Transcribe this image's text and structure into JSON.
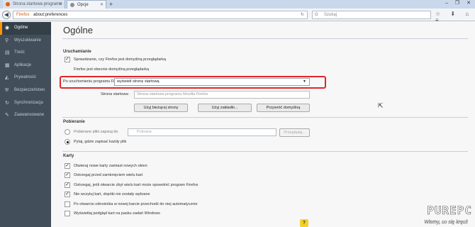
{
  "browser": {
    "tabs": [
      {
        "label": "Strona startowa programu M...",
        "active": false
      },
      {
        "label": "Opcje",
        "active": true
      }
    ],
    "new_tab": "+",
    "window_controls": "–  ❐  ✕",
    "url_brand": "Firefox",
    "url": "about:preferences",
    "search_placeholder": "Szukaj",
    "toolbar_icons": "☆ ⬇ ⌂ ≡"
  },
  "sidebar": {
    "items": [
      {
        "label": "Ogólne",
        "icon": "◉"
      },
      {
        "label": "Wyszukiwanie",
        "icon": "⚲"
      },
      {
        "label": "Treść",
        "icon": "▤"
      },
      {
        "label": "Aplikacje",
        "icon": "▦"
      },
      {
        "label": "Prywatność",
        "icon": "◭"
      },
      {
        "label": "Bezpieczeństwo",
        "icon": "⛨"
      },
      {
        "label": "Synchronizacja",
        "icon": "↻"
      },
      {
        "label": "Zaawansowane",
        "icon": "✎"
      }
    ]
  },
  "page": {
    "title": "Ogólne",
    "startup": {
      "heading": "Uruchamianie",
      "default_check_label": "Sprawdzanie, czy Firefox jest domyślną przeglądarką",
      "default_status": "Firefox jest obecnie domyślną przeglądarką",
      "on_start_label": "Po uruchomieniu programu Firefox:",
      "on_start_value": "wyświetl stronę startową",
      "homepage_label": "Strona startowa:",
      "homepage_placeholder": "Strona startowa programu Mozilla Firefox",
      "btn_current": "Użyj bieżącej strony",
      "btn_bookmark": "Użyj zakładki...",
      "btn_restore": "Przywróć domyślną"
    },
    "downloads": {
      "heading": "Pobieranie",
      "save_to_label": "Pobierane pliki zapisuj do",
      "folder": "Pobrane",
      "browse": "Przeglądaj...",
      "ask_label": "Pytaj, gdzie zapisać każdy plik"
    },
    "tabs_section": {
      "heading": "Karty",
      "options": [
        {
          "label": "Otwieraj nowe karty zamiast nowych okien",
          "checked": true
        },
        {
          "label": "Ostrzegaj przed zamknięciem wielu kart",
          "checked": true
        },
        {
          "label": "Ostrzegaj, jeśli otwarcie zbyt wielu kart może spowolnić program Firefox",
          "checked": true
        },
        {
          "label": "Nie wczytuj kart, dopóki nie zostały wybrane",
          "checked": true
        },
        {
          "label": "Po otwarciu odnośnika w nowej karcie przechodź do niej automatycznie",
          "checked": false
        },
        {
          "label": "Wyświetlaj podgląd kart na pasku zadań Windows",
          "checked": false
        }
      ]
    },
    "help_button": "?"
  },
  "watermark": {
    "brand": "PUREPC",
    "slogan": "Wiemy, co się kręci!"
  }
}
